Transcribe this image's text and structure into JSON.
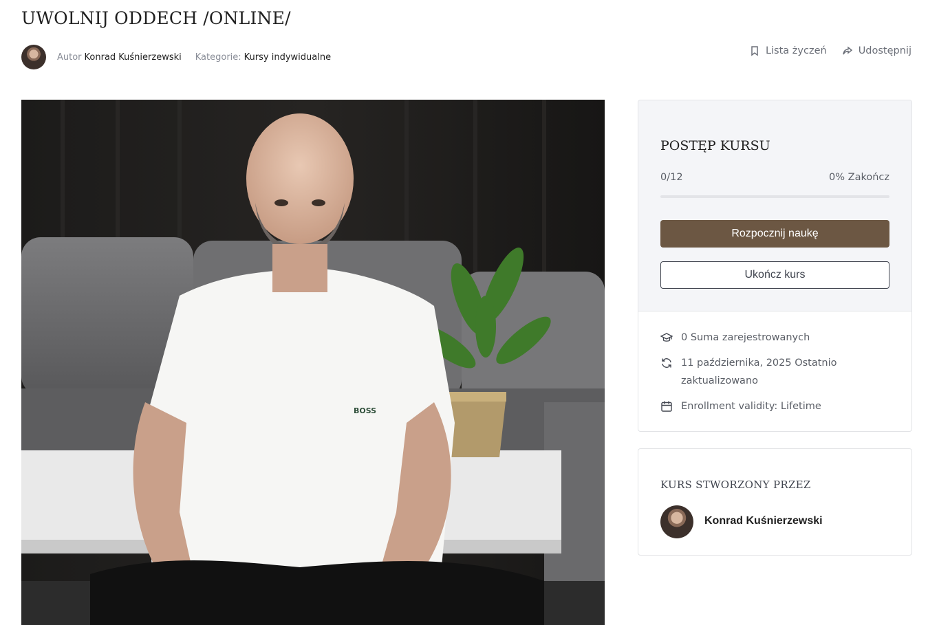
{
  "course": {
    "title": "UWOLNIJ ODDECH /ONLINE/",
    "author_label": "Autor",
    "author_name": "Konrad Kuśnierzewski",
    "category_label": "Kategorie:",
    "category": "Kursy indywidualne"
  },
  "actions": {
    "wishlist": "Lista życzeń",
    "share": "Udostępnij"
  },
  "progress": {
    "heading": "POSTĘP KURSU",
    "count": "0/12",
    "percent_text": "0% Zakończ",
    "percent_value": 0,
    "start_button": "Rozpocznij naukę",
    "finish_button": "Ukończ kurs"
  },
  "info": {
    "enrolled": "0 Suma zarejestrowanych",
    "updated": "11 października, 2025 Ostatnio zaktualizowano",
    "validity": "Enrollment validity: Lifetime"
  },
  "creator": {
    "heading": "KURS STWORZONY PRZEZ",
    "name": "Konrad Kuśnierzewski"
  },
  "hero_brand_text": "BOSS",
  "colors": {
    "accent": "#6c5743",
    "panel_bg": "#f4f5f8",
    "border": "#e2e3e6"
  },
  "icons": {
    "wishlist": "bookmark-icon",
    "share": "share-icon",
    "enrolled": "graduation-cap-icon",
    "updated": "refresh-icon",
    "validity": "calendar-icon"
  }
}
